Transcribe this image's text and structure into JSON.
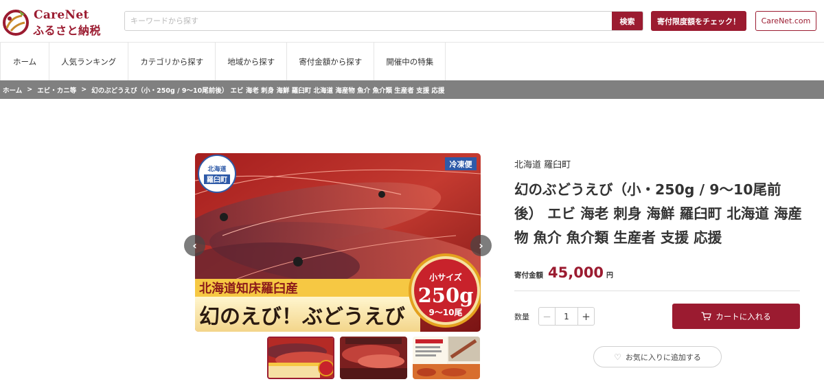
{
  "header": {
    "logo_en": "CareNet",
    "logo_jp": "ふるさと納税",
    "search_placeholder": "キーワードから探す",
    "search_button": "検索",
    "limit_button": "寄付限度額をチェック！",
    "carenet_button": "CareNet.com"
  },
  "nav": {
    "items": [
      "ホーム",
      "人気ランキング",
      "カテゴリから探す",
      "地域から探す",
      "寄付金額から探す",
      "開催中の特集"
    ]
  },
  "breadcrumb": {
    "items": [
      "ホーム",
      "エビ・カニ等",
      "幻のぶどうえび（小・250g / 9〜10尾前後） エビ 海老 刺身 海鮮 羅臼町 北海道 海産物 魚介 魚介類 生産者 支援 応援"
    ],
    "separator": ">"
  },
  "gallery": {
    "badge_region_top": "北海道",
    "badge_region_bottom": "羅臼町",
    "badge_frozen": "冷凍便",
    "banner_line1": "北海道知床羅臼産",
    "banner_line2": "幻のえび！ぶどうえび",
    "size_label": "小サイズ",
    "size_weight": "250g",
    "size_count": "9〜10尾",
    "thumb_count": 3,
    "active_thumb": 1
  },
  "product": {
    "region": "北海道 羅臼町",
    "title": "幻のぶどうえび（小・250g / 9〜10尾前後） エビ 海老 刺身 海鮮 羅臼町 北海道 海産物 魚介 魚介類 生産者 支援 応援",
    "price_label": "寄付金額",
    "price_value": "45,000",
    "price_unit": "円",
    "quantity_label": "数量",
    "quantity_value": "1",
    "cart_button": "カートに入れる",
    "favorite_button": "お気に入りに追加する"
  },
  "colors": {
    "brand": "#9b1b30",
    "breadcrumb_bg": "#808080"
  }
}
